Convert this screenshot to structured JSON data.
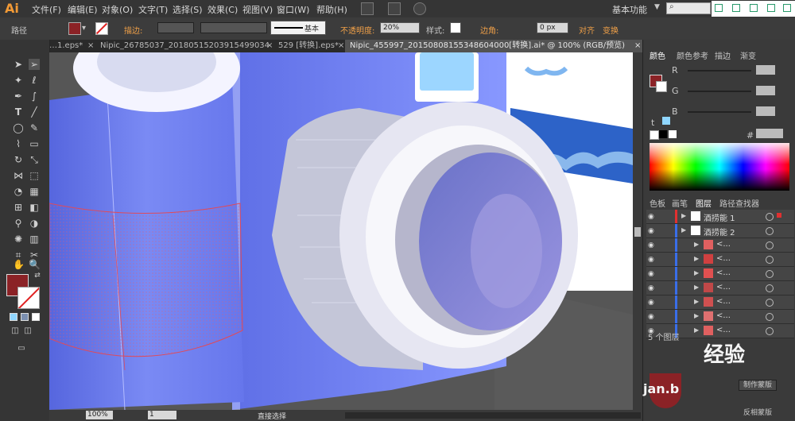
{
  "app": {
    "logo": "Ai"
  },
  "menu": [
    "文件(F)",
    "编辑(E)",
    "对象(O)",
    "文字(T)",
    "选择(S)",
    "效果(C)",
    "视图(V)",
    "窗口(W)",
    "帮助(H)"
  ],
  "workspace": "基本功能",
  "control": {
    "label": "路径",
    "stroke_label": "描边:",
    "profile_label": "基本",
    "opacity_label": "不透明度:",
    "opacity_value": "20%",
    "style_label": "样式:",
    "corner_label": "边角:",
    "corner_value": "0 px",
    "align_label": "对齐",
    "transform_label": "变换"
  },
  "tabs": [
    {
      "label": "…1.eps*",
      "close": "×"
    },
    {
      "label": "Nipic_26785037_20180515203915499034.ai*",
      "close": "×"
    },
    {
      "label": "529 [转换].eps*",
      "close": "×"
    },
    {
      "label": "Nipic_455997_20150808155348604000[转换].ai* @ 100% (RGB/预览)",
      "close": "×"
    }
  ],
  "panel": {
    "color_tabs": [
      "颜色",
      "颜色参考",
      "描边",
      "渐变"
    ],
    "channels": [
      "R",
      "G",
      "B"
    ],
    "hex_prefix": "#",
    "lower_tabs": [
      "色板",
      "画笔",
      "图层",
      "路径查找器"
    ],
    "layers_count": "5 个图层",
    "watermark_label": "制作蒙版",
    "watermark_label2": "反相蒙版"
  },
  "layers": [
    {
      "name": "酒捞能 1",
      "color": "#e03030",
      "level": 0,
      "thumb": "#ffffff",
      "selected": true
    },
    {
      "name": "酒捞能 2",
      "color": "#3a6ee8",
      "level": 0,
      "thumb": "#ffffff",
      "selected": false
    },
    {
      "name": "<...",
      "color": "#3a6ee8",
      "level": 1,
      "thumb": "#e06060",
      "selected": false
    },
    {
      "name": "<...",
      "color": "#3a6ee8",
      "level": 1,
      "thumb": "#d04040",
      "selected": false
    },
    {
      "name": "<...",
      "color": "#3a6ee8",
      "level": 1,
      "thumb": "#e05050",
      "selected": false
    },
    {
      "name": "<...",
      "color": "#3a6ee8",
      "level": 1,
      "thumb": "#c04848",
      "selected": false
    },
    {
      "name": "<...",
      "color": "#3a6ee8",
      "level": 1,
      "thumb": "#d05050",
      "selected": false
    },
    {
      "name": "<...",
      "color": "#3a6ee8",
      "level": 1,
      "thumb": "#e07070",
      "selected": false
    },
    {
      "name": "<...",
      "color": "#3a6ee8",
      "level": 1,
      "thumb": "#e06060",
      "selected": false
    }
  ],
  "status": {
    "zoom": "100%",
    "artboard": "1",
    "tool": "直接选择"
  },
  "watermark": {
    "brand_cn": "经验",
    "brand_en": "jan.b"
  },
  "colors": {
    "fill": "#8b2226",
    "accent": "#f0a048",
    "camera_blue": "#7d8cf4",
    "lens_purple": "#8a80d0"
  }
}
